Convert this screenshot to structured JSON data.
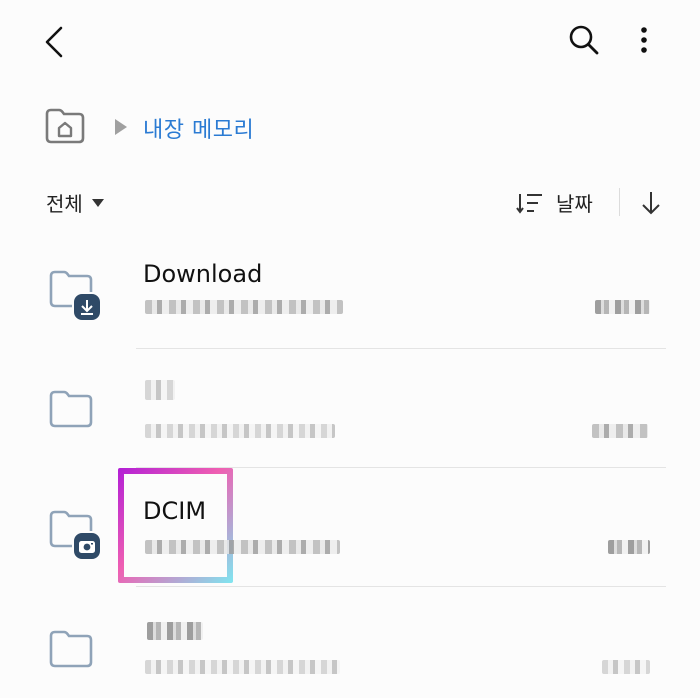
{
  "header": {
    "back_icon": "chevron-left-icon",
    "search_icon": "search-icon",
    "more_icon": "more-vertical-icon"
  },
  "breadcrumb": {
    "home_icon": "home-folder-icon",
    "current": "내장 메모리"
  },
  "toolbar": {
    "filter_label": "전체",
    "sort_label": "날짜",
    "sort_icon": "sort-icon",
    "order_icon": "arrow-down-icon"
  },
  "folders": [
    {
      "name": "Download",
      "badge": "download-badge-icon"
    },
    {
      "name": "",
      "badge": ""
    },
    {
      "name": "DCIM",
      "badge": "camera-badge-icon"
    },
    {
      "name": "",
      "badge": ""
    }
  ],
  "colors": {
    "accent": "#2b7bd3",
    "folder_outline": "#8fa3b8",
    "badge_bg": "#2f4a67",
    "focus_start": "#b21fd6",
    "focus_mid": "#ef5fb2",
    "focus_end": "#7fe6f0"
  }
}
